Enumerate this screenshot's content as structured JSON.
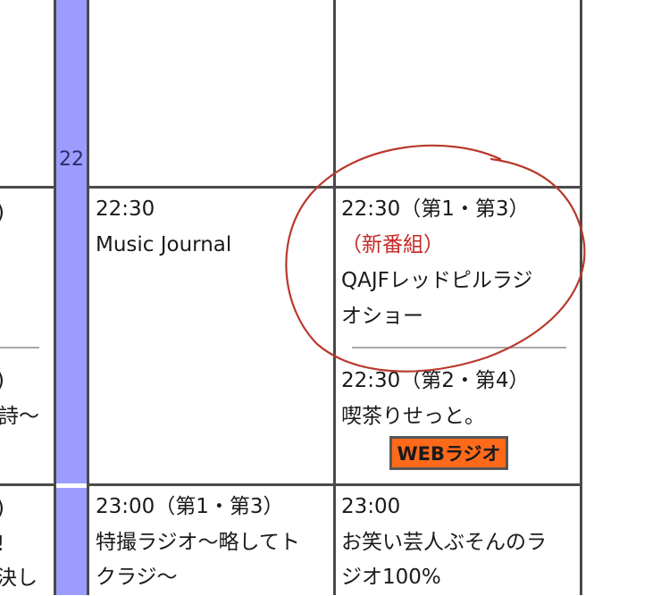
{
  "hour_label": "22",
  "left_column": {
    "row1": ")",
    "row2a": ")",
    "row2b": "詩〜",
    "row3a": ")",
    "row3b": "!",
    "row3c": "決し"
  },
  "col2": {
    "slot_2230_time": "22:30",
    "slot_2230_title": "Music Journal",
    "slot_2300_time": "23:00（第1・第3）",
    "slot_2300_title_line1": "特撮ラジオ〜略してト",
    "slot_2300_title_line2": "クラジ〜"
  },
  "col3": {
    "slot_2230a_time": "22:30（第1・第3）",
    "slot_2230a_badge": "（新番組）",
    "slot_2230a_title_line1": "QAJFレッドピルラジ",
    "slot_2230a_title_line2": "オショー",
    "slot_2230b_time": "22:30（第2・第4）",
    "slot_2230b_title": "喫茶りせっと。",
    "web_radio_button": "WEBラジオ",
    "slot_2300_time": "23:00",
    "slot_2300_title_line1": "お笑い芸人ぶそんのラ",
    "slot_2300_title_line2": "ジオ100%"
  },
  "colors": {
    "hour_bar": "#9c9cff",
    "new_badge": "#c62828",
    "web_button": "#ff6a1a",
    "annotation": "#b8392c"
  }
}
